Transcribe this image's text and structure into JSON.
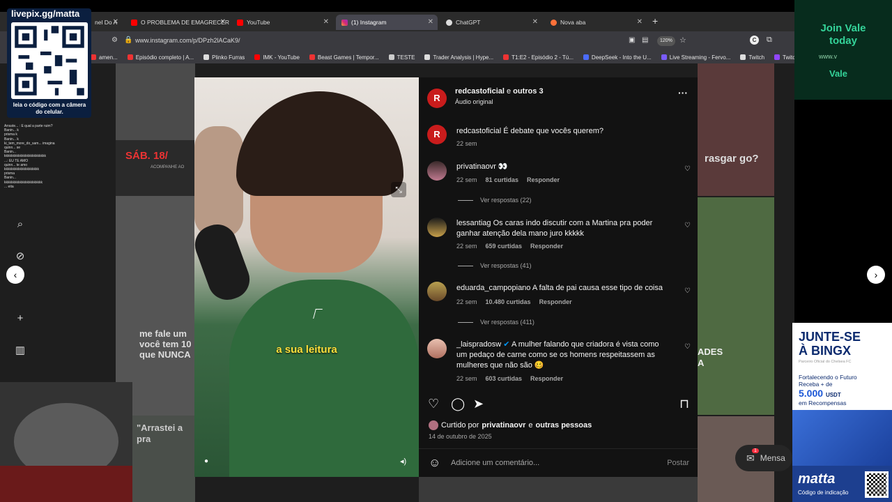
{
  "browser": {
    "tabs": [
      {
        "label": "nel Do A",
        "icon": "youtube-icon",
        "active": false
      },
      {
        "label": "O PROBLEMA DE EMAGRECER",
        "icon": "youtube-icon",
        "active": false
      },
      {
        "label": "YouTube",
        "icon": "youtube-icon",
        "active": false
      },
      {
        "label": "(1) Instagram",
        "icon": "instagram-icon",
        "active": true
      },
      {
        "label": "ChatGPT",
        "icon": "chatgpt-icon",
        "active": false
      },
      {
        "label": "Nova aba",
        "icon": "firefox-icon",
        "active": false
      }
    ],
    "url": "www.instagram.com/p/DPzh2lACaK9/",
    "zoom": "120%",
    "bookmarks": [
      "amen...",
      "Episódio completo | A...",
      "Plinko Furras",
      "IMK - YouTube",
      "Beast Games | Tempor...",
      "TESTE",
      "Trader Analysis | Hype...",
      "T1:E2 - Episódio 2 - Tú...",
      "DeepSeek - Into the U...",
      "Live Streaming - Fervo...",
      "Twitch",
      "Twitch",
      "Twitch",
      "Tw"
    ]
  },
  "overlay": {
    "qr_title": "livepix.gg/matta",
    "qr_caption": "leia o código com a câmera do celular.",
    "chat_lines": [
      "Arraste... : E qual a parte ruim?",
      "Banin... k",
      "prisma k",
      "Banin... k",
      "ki_tem_more_do_sam... imagina",
      "quinn... se",
      "Banin...",
      "kkkkkkkkkkkkkkkkkkkkkkkk",
      "...: EU TE AMO",
      "quinn... te amo",
      "kkkkkkkkkkkkkkkkkkkk",
      "prisma",
      "Banin...",
      "kkkkkkkkkkkkkkkkkkkkkk",
      "... eita"
    ]
  },
  "background_tiles": {
    "tile1": "SÁB. 18/",
    "tile1_sub": "ACOMPANHE AO",
    "tile2": "me fale um você tem 10 que NUNCA",
    "tile3": "\"Arrastei a pra",
    "tile4": "rasgar go?",
    "tile5": "ADES A"
  },
  "post": {
    "subtitle": "a sua leitura",
    "header": {
      "user": "redcastoficial",
      "joiner": "e",
      "others": "outros 3",
      "audio": "Áudio original"
    },
    "caption": {
      "user": "redcastoficial",
      "text": "É debate que vocês querem?",
      "time": "22 sem"
    },
    "comments": [
      {
        "user": "privatinaovr",
        "text": "👀",
        "time": "22 sem",
        "likes": "81 curtidas",
        "reply": "Responder",
        "replies": "Ver respostas (22)"
      },
      {
        "user": "lessantiag",
        "text": "Os caras indo discutir com a Martina pra poder ganhar atenção dela mano juro kkkkk",
        "time": "22 sem",
        "likes": "659 curtidas",
        "reply": "Responder",
        "replies": "Ver respostas (41)"
      },
      {
        "user": "eduarda_campopiano",
        "text": "A falta de pai causa esse tipo de coisa",
        "time": "22 sem",
        "likes": "10.480 curtidas",
        "reply": "Responder",
        "replies": "Ver respostas (411)"
      },
      {
        "user": "_laispradosw",
        "text": "A mulher falando que criadora é vista como um pedaço de carne como se os homens respeitassem as mulheres que não são 🥴",
        "time": "22 sem",
        "likes": "603 curtidas",
        "reply": "Responder",
        "replies": ""
      }
    ],
    "liked_by_prefix": "Curtido por",
    "liked_by_user": "privatinaovr",
    "liked_by_joiner": "e",
    "liked_by_others": "outras pessoas",
    "date": "14 de outubro de 2025",
    "comment_placeholder": "Adicione um comentário...",
    "post_button": "Postar"
  },
  "messages": {
    "label": "Mensa",
    "badge": "1"
  },
  "ads": {
    "vale": {
      "line1": "Join Vale",
      "line2": "today",
      "url": "www.v",
      "brand": "Vale"
    },
    "bingx": {
      "title1": "JUNTE-SE",
      "title2": "À BINGX",
      "partner": "Parceiro Oficial do Chelsea FC",
      "line1": "Fortalecendo o Futuro",
      "line2": "Receba + de",
      "amount": "5.000",
      "currency": "USDT",
      "line3": "em Recompensas",
      "brand": "matta",
      "code": "Código de indicação"
    }
  },
  "colors": {
    "panel_bg": "#121212",
    "muted": "#a8a8a8",
    "subtitle": "#ffe03b",
    "vale_green": "#34d399",
    "bingx_blue": "#1a56d6"
  }
}
